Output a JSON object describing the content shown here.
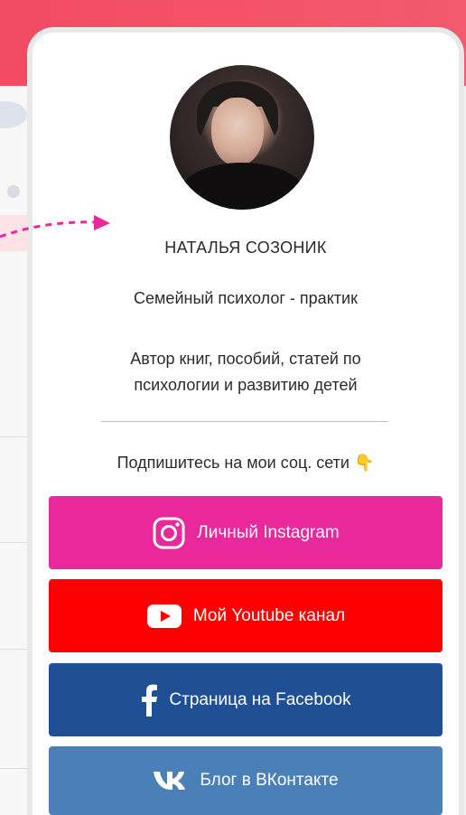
{
  "profile": {
    "name": "НАТАЛЬЯ СОЗОНИК",
    "role": "Семейный психолог - практик",
    "description_line1": "Автор книг, пособий, статей по",
    "description_line2": "психологии и развитию детей",
    "subscribe_text": "Подпишитесь на мои соц. сети",
    "subscribe_emoji": "👇"
  },
  "buttons": {
    "instagram": {
      "label": "Личный Instagram",
      "color": "#e8289b",
      "icon": "instagram-icon"
    },
    "youtube": {
      "label": "Мой Youtube канал",
      "color": "#ff0000",
      "icon": "youtube-icon"
    },
    "facebook": {
      "label": "Страница на Facebook",
      "color": "#1f4f94",
      "icon": "facebook-icon"
    },
    "vkontakte": {
      "label": "Блог в ВКонтакте",
      "color": "#4b7fb7",
      "icon": "vk-icon"
    }
  },
  "colors": {
    "header_accent": "#f24b63",
    "arrow": "#e8289b"
  }
}
